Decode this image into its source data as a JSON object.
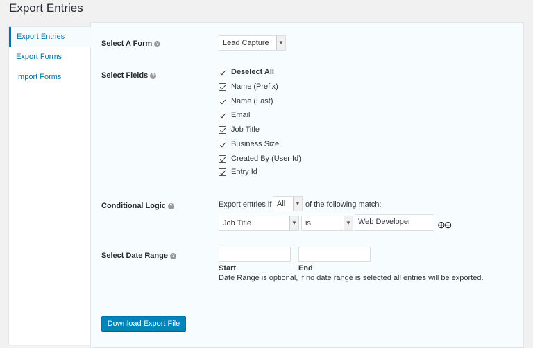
{
  "page": {
    "title": "Export Entries"
  },
  "nav": {
    "items": [
      {
        "label": "Export Entries"
      },
      {
        "label": "Export Forms"
      },
      {
        "label": "Import Forms"
      }
    ]
  },
  "form_select": {
    "label": "Select A Form",
    "value": "Lead Capture"
  },
  "fields": {
    "label": "Select Fields",
    "items": [
      {
        "label": "Deselect All",
        "checked": true
      },
      {
        "label": "Name (Prefix)",
        "checked": true
      },
      {
        "label": "Name (Last)",
        "checked": true
      },
      {
        "label": "Email",
        "checked": true
      },
      {
        "label": "Job Title",
        "checked": true
      },
      {
        "label": "Business Size",
        "checked": true
      },
      {
        "label": "Created By (User Id)",
        "checked": true
      },
      {
        "label": "Entry Id",
        "checked": true
      }
    ]
  },
  "conditional": {
    "label": "Conditional Logic",
    "prefix": "Export entries if",
    "match_value": "All",
    "suffix": "of the following match:",
    "field_value": "Job Title",
    "operator_value": "is",
    "value": "Web Developer"
  },
  "date_range": {
    "label": "Select Date Range",
    "start_label": "Start",
    "end_label": "End",
    "hint": "Date Range is optional, if no date range is selected all entries will be exported."
  },
  "download_button": {
    "label": "Download Export File"
  }
}
